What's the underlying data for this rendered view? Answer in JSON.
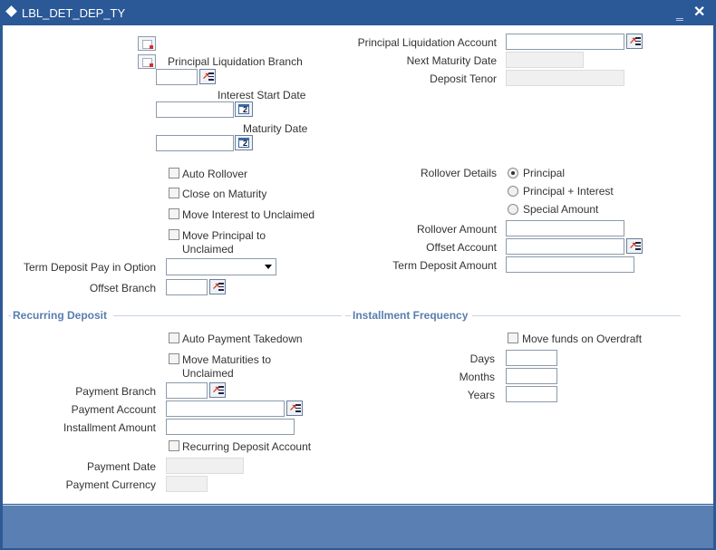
{
  "window": {
    "title": "LBL_DET_DEP_TY",
    "minimize_label": "‗",
    "close_label": "✕"
  },
  "left": {
    "principal_liquidation_branch": "Principal Liquidation Branch",
    "interest_start_date": "Interest Start Date",
    "maturity_date": "Maturity Date",
    "auto_rollover": "Auto Rollover",
    "close_on_maturity": "Close on Maturity",
    "move_interest_unclaimed": "Move Interest to Unclaimed",
    "move_principal_line1": "Move Principal to",
    "move_principal_line2": "Unclaimed",
    "term_deposit_pay_in_option": "Term Deposit Pay in Option",
    "offset_branch": "Offset Branch"
  },
  "right": {
    "principal_liquidation_account": "Principal Liquidation Account",
    "next_maturity_date": "Next Maturity Date",
    "deposit_tenor": "Deposit Tenor",
    "rollover_details": "Rollover Details",
    "rollover_options": [
      "Principal",
      "Principal + Interest",
      "Special Amount"
    ],
    "rollover_amount": "Rollover Amount",
    "offset_account": "Offset Account",
    "term_deposit_amount": "Term Deposit Amount"
  },
  "recurring": {
    "section_title": "Recurring Deposit",
    "auto_payment_takedown": "Auto Payment Takedown",
    "move_maturities_line1": "Move Maturities to",
    "move_maturities_line2": "Unclaimed",
    "payment_branch": "Payment Branch",
    "payment_account": "Payment Account",
    "installment_amount": "Installment Amount",
    "recurring_deposit_account": "Recurring Deposit Account",
    "payment_date": "Payment Date",
    "payment_currency": "Payment Currency"
  },
  "installment": {
    "section_title": "Installment Frequency",
    "move_funds_on_overdraft": "Move funds on Overdraft",
    "days": "Days",
    "months": "Months",
    "years": "Years"
  }
}
